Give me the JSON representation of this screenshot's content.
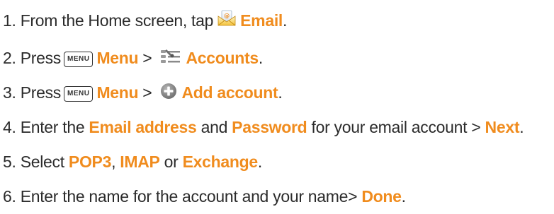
{
  "steps": [
    {
      "number": "1.",
      "parts": {
        "a": "From the Home screen, tap",
        "b": "Email",
        "c": "."
      },
      "icon": "email-envelope-icon"
    },
    {
      "number": "2.",
      "parts": {
        "a": "Press",
        "key": "MENU",
        "b": "Menu",
        "gt": ">",
        "c": "Accounts",
        "d": "."
      },
      "icon": "accounts-icon"
    },
    {
      "number": "3.",
      "parts": {
        "a": "Press",
        "key": "MENU",
        "b": "Menu",
        "gt": ">",
        "c": "Add account",
        "d": "."
      },
      "icon": "add-circle-icon"
    },
    {
      "number": "4.",
      "parts": {
        "a": "Enter the",
        "b": "Email address",
        "c": "and",
        "d": "Password",
        "e": "for your email account >",
        "f": "Next",
        "g": "."
      }
    },
    {
      "number": "5.",
      "parts": {
        "a": "Select",
        "b": "POP3",
        "c": ",",
        "d": "IMAP",
        "e": "or",
        "f": "Exchange",
        "g": "."
      }
    },
    {
      "number": "6.",
      "parts": {
        "a": "Enter the name for the account and your name>",
        "b": "Done",
        "c": "."
      }
    }
  ],
  "colors": {
    "highlight": "#f08c1e",
    "text": "#2b2b2b"
  }
}
